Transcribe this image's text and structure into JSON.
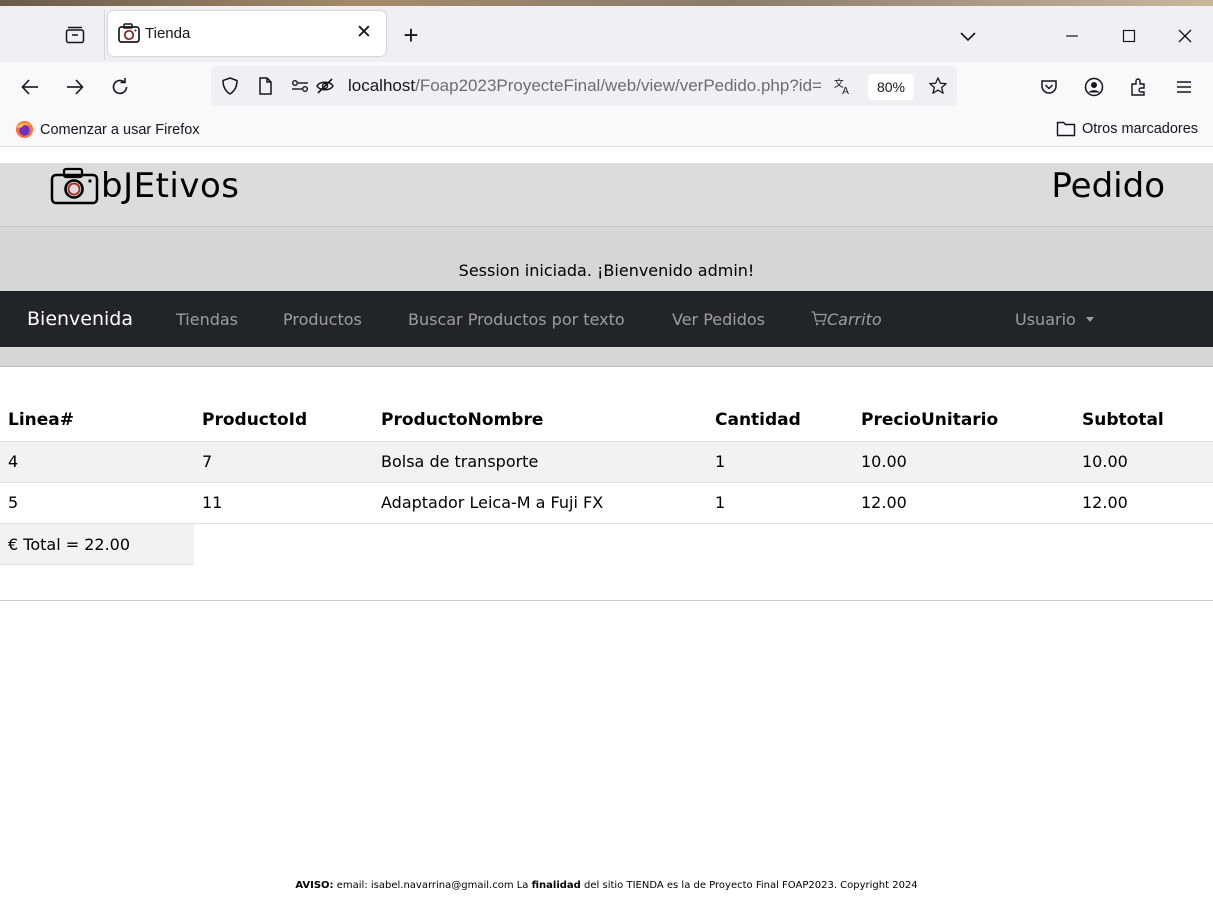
{
  "browser": {
    "tab_title": "Tienda",
    "url_host": "localhost",
    "url_path": "/Foap2023ProyecteFinal/web/view/verPedido.php?id=",
    "zoom": "80%",
    "bookmarks": {
      "firefox_label": "Comenzar a usar Firefox",
      "other_label": "Otros marcadores"
    }
  },
  "site": {
    "logo_text": "bJEtivos",
    "page_heading": "Pedido",
    "session_message": "Session iniciada. ¡Bienvenido admin!"
  },
  "nav": {
    "brand": "Bienvenida",
    "items": [
      {
        "label": "Tiendas"
      },
      {
        "label": "Productos"
      },
      {
        "label": "Buscar Productos por texto"
      },
      {
        "label": "Ver Pedidos"
      },
      {
        "label": "Carrito"
      },
      {
        "label": "Usuario"
      }
    ]
  },
  "order": {
    "columns": [
      "Linea#",
      "ProductoId",
      "ProductoNombre",
      "Cantidad",
      "PrecioUnitario",
      "Subtotal"
    ],
    "rows": [
      [
        "4",
        "7",
        "Bolsa de transporte",
        "1",
        "10.00",
        "10.00"
      ],
      [
        "5",
        "11",
        "Adaptador Leica-M a Fuji FX",
        "1",
        "12.00",
        "12.00"
      ]
    ],
    "total": "€ Total = 22.00"
  },
  "footer": {
    "aviso_label": "AVISO:",
    "text_1": "email: isabel.navarrina@gmail.com La",
    "finalidad": "finalidad",
    "text_2": "del sitio TIENDA es la de Proyecto Final FOAP2023. Copyright 2024"
  }
}
